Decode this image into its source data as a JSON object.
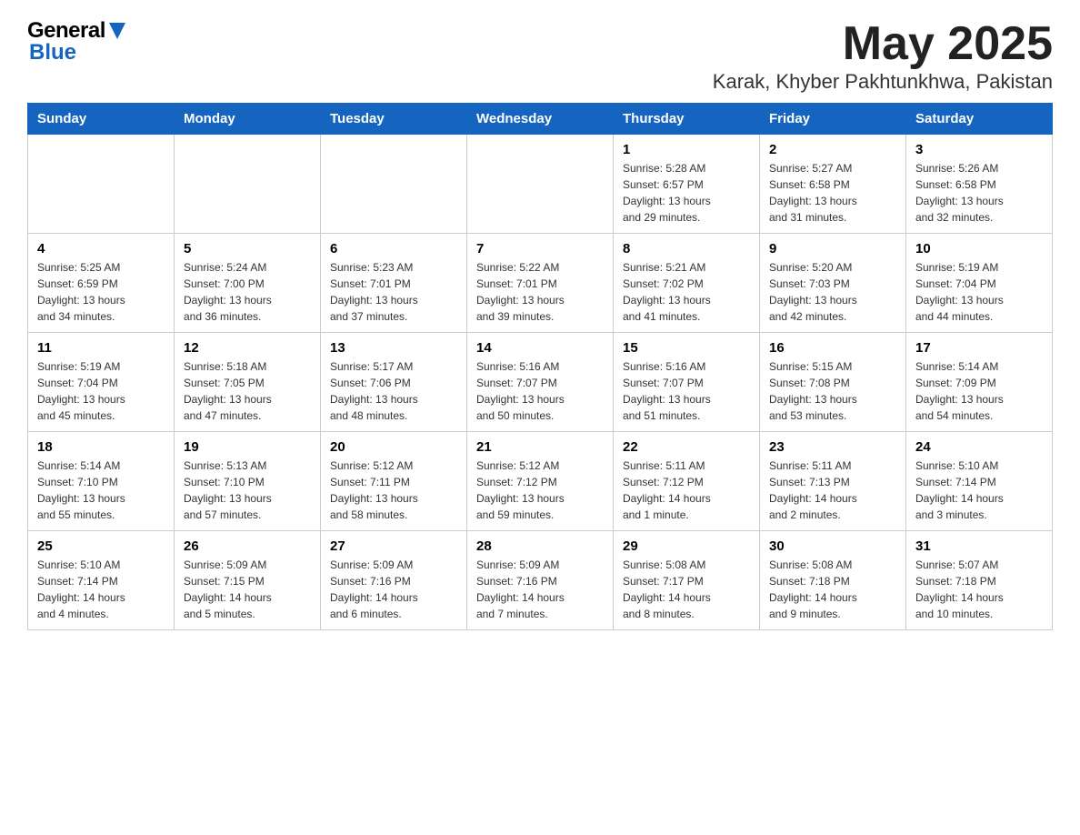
{
  "header": {
    "logo_general": "General",
    "logo_blue": "Blue",
    "title": "May 2025",
    "subtitle": "Karak, Khyber Pakhtunkhwa, Pakistan"
  },
  "days_of_week": [
    "Sunday",
    "Monday",
    "Tuesday",
    "Wednesday",
    "Thursday",
    "Friday",
    "Saturday"
  ],
  "weeks": [
    {
      "days": [
        {
          "num": "",
          "info": ""
        },
        {
          "num": "",
          "info": ""
        },
        {
          "num": "",
          "info": ""
        },
        {
          "num": "",
          "info": ""
        },
        {
          "num": "1",
          "info": "Sunrise: 5:28 AM\nSunset: 6:57 PM\nDaylight: 13 hours\nand 29 minutes."
        },
        {
          "num": "2",
          "info": "Sunrise: 5:27 AM\nSunset: 6:58 PM\nDaylight: 13 hours\nand 31 minutes."
        },
        {
          "num": "3",
          "info": "Sunrise: 5:26 AM\nSunset: 6:58 PM\nDaylight: 13 hours\nand 32 minutes."
        }
      ]
    },
    {
      "days": [
        {
          "num": "4",
          "info": "Sunrise: 5:25 AM\nSunset: 6:59 PM\nDaylight: 13 hours\nand 34 minutes."
        },
        {
          "num": "5",
          "info": "Sunrise: 5:24 AM\nSunset: 7:00 PM\nDaylight: 13 hours\nand 36 minutes."
        },
        {
          "num": "6",
          "info": "Sunrise: 5:23 AM\nSunset: 7:01 PM\nDaylight: 13 hours\nand 37 minutes."
        },
        {
          "num": "7",
          "info": "Sunrise: 5:22 AM\nSunset: 7:01 PM\nDaylight: 13 hours\nand 39 minutes."
        },
        {
          "num": "8",
          "info": "Sunrise: 5:21 AM\nSunset: 7:02 PM\nDaylight: 13 hours\nand 41 minutes."
        },
        {
          "num": "9",
          "info": "Sunrise: 5:20 AM\nSunset: 7:03 PM\nDaylight: 13 hours\nand 42 minutes."
        },
        {
          "num": "10",
          "info": "Sunrise: 5:19 AM\nSunset: 7:04 PM\nDaylight: 13 hours\nand 44 minutes."
        }
      ]
    },
    {
      "days": [
        {
          "num": "11",
          "info": "Sunrise: 5:19 AM\nSunset: 7:04 PM\nDaylight: 13 hours\nand 45 minutes."
        },
        {
          "num": "12",
          "info": "Sunrise: 5:18 AM\nSunset: 7:05 PM\nDaylight: 13 hours\nand 47 minutes."
        },
        {
          "num": "13",
          "info": "Sunrise: 5:17 AM\nSunset: 7:06 PM\nDaylight: 13 hours\nand 48 minutes."
        },
        {
          "num": "14",
          "info": "Sunrise: 5:16 AM\nSunset: 7:07 PM\nDaylight: 13 hours\nand 50 minutes."
        },
        {
          "num": "15",
          "info": "Sunrise: 5:16 AM\nSunset: 7:07 PM\nDaylight: 13 hours\nand 51 minutes."
        },
        {
          "num": "16",
          "info": "Sunrise: 5:15 AM\nSunset: 7:08 PM\nDaylight: 13 hours\nand 53 minutes."
        },
        {
          "num": "17",
          "info": "Sunrise: 5:14 AM\nSunset: 7:09 PM\nDaylight: 13 hours\nand 54 minutes."
        }
      ]
    },
    {
      "days": [
        {
          "num": "18",
          "info": "Sunrise: 5:14 AM\nSunset: 7:10 PM\nDaylight: 13 hours\nand 55 minutes."
        },
        {
          "num": "19",
          "info": "Sunrise: 5:13 AM\nSunset: 7:10 PM\nDaylight: 13 hours\nand 57 minutes."
        },
        {
          "num": "20",
          "info": "Sunrise: 5:12 AM\nSunset: 7:11 PM\nDaylight: 13 hours\nand 58 minutes."
        },
        {
          "num": "21",
          "info": "Sunrise: 5:12 AM\nSunset: 7:12 PM\nDaylight: 13 hours\nand 59 minutes."
        },
        {
          "num": "22",
          "info": "Sunrise: 5:11 AM\nSunset: 7:12 PM\nDaylight: 14 hours\nand 1 minute."
        },
        {
          "num": "23",
          "info": "Sunrise: 5:11 AM\nSunset: 7:13 PM\nDaylight: 14 hours\nand 2 minutes."
        },
        {
          "num": "24",
          "info": "Sunrise: 5:10 AM\nSunset: 7:14 PM\nDaylight: 14 hours\nand 3 minutes."
        }
      ]
    },
    {
      "days": [
        {
          "num": "25",
          "info": "Sunrise: 5:10 AM\nSunset: 7:14 PM\nDaylight: 14 hours\nand 4 minutes."
        },
        {
          "num": "26",
          "info": "Sunrise: 5:09 AM\nSunset: 7:15 PM\nDaylight: 14 hours\nand 5 minutes."
        },
        {
          "num": "27",
          "info": "Sunrise: 5:09 AM\nSunset: 7:16 PM\nDaylight: 14 hours\nand 6 minutes."
        },
        {
          "num": "28",
          "info": "Sunrise: 5:09 AM\nSunset: 7:16 PM\nDaylight: 14 hours\nand 7 minutes."
        },
        {
          "num": "29",
          "info": "Sunrise: 5:08 AM\nSunset: 7:17 PM\nDaylight: 14 hours\nand 8 minutes."
        },
        {
          "num": "30",
          "info": "Sunrise: 5:08 AM\nSunset: 7:18 PM\nDaylight: 14 hours\nand 9 minutes."
        },
        {
          "num": "31",
          "info": "Sunrise: 5:07 AM\nSunset: 7:18 PM\nDaylight: 14 hours\nand 10 minutes."
        }
      ]
    }
  ]
}
